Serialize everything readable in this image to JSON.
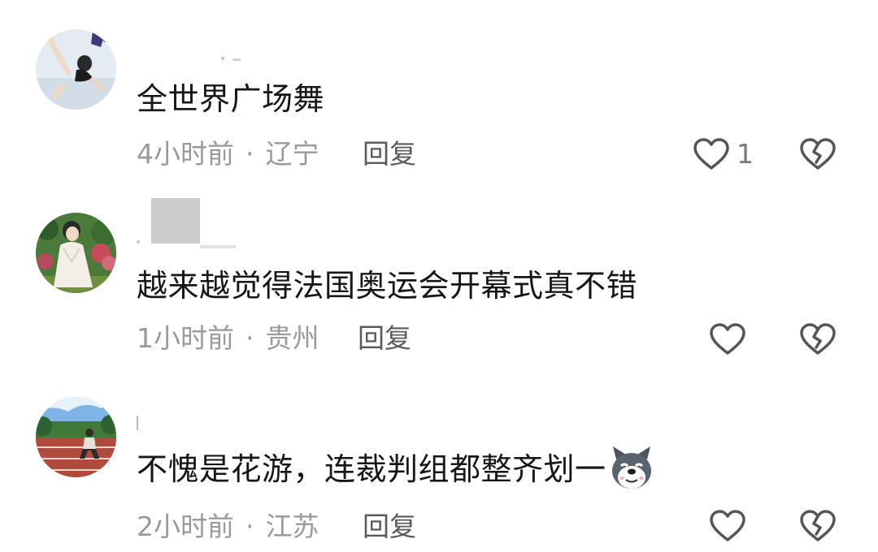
{
  "comments": [
    {
      "text": "全世界广场舞",
      "time": "4小时前",
      "location": "辽宁",
      "reply_label": "回复",
      "like_count": "1",
      "avatar_icon": "gymnast-avatar"
    },
    {
      "text": "越来越觉得法国奥运会开幕式真不错",
      "time": "1小时前",
      "location": "贵州",
      "reply_label": "回复",
      "like_count": "",
      "avatar_icon": "garden-woman-avatar"
    },
    {
      "text": "不愧是花游，连裁判组都整齐划一",
      "time": "2小时前",
      "location": "江苏",
      "reply_label": "回复",
      "like_count": "",
      "avatar_icon": "track-field-avatar",
      "emoji": "doge-emoji"
    }
  ],
  "separator": "·",
  "icons": {
    "like": "heart-outline-icon",
    "dislike": "broken-heart-icon"
  },
  "colors": {
    "text": "#161616",
    "meta": "#9a9a9a",
    "reply": "#5a5a5a",
    "icon": "#555555"
  }
}
